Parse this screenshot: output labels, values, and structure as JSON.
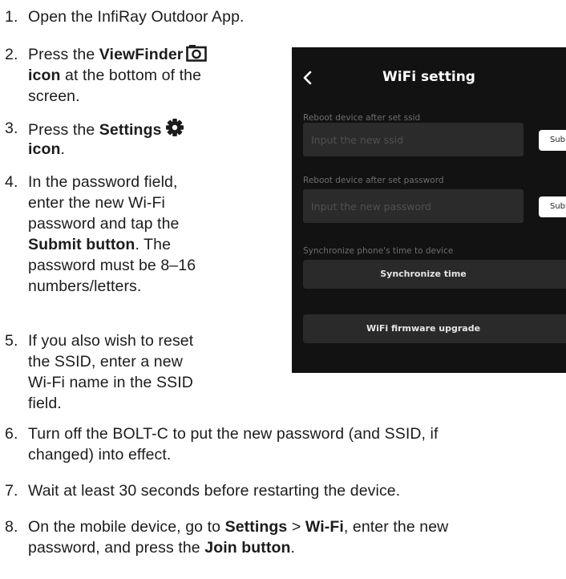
{
  "steps": [
    {
      "num": "1.",
      "lines": [
        "Open the InfiRay Outdoor App."
      ]
    },
    {
      "num": "2.",
      "pre": "Press the ",
      "bold1": "ViewFinder",
      "icon": "camera-icon",
      "line2_bold": "icon",
      "line2_rest": " at the bottom of the",
      "line3": "screen."
    },
    {
      "num": "3.",
      "pre": "Press the ",
      "bold1": "Settings",
      "icon": "gear-icon",
      "line2_bold": "icon",
      "line2_rest": "."
    },
    {
      "num": "4.",
      "lines": [
        "In the password field,",
        "enter the new Wi-Fi",
        "password and tap the"
      ],
      "line4_bold": "Submit button",
      "line4_rest": ". The",
      "line5": "password must be 8–16",
      "line6": "numbers/letters."
    },
    {
      "num": "5.",
      "lines": [
        "If you also wish to reset",
        "the SSID, enter a new",
        "Wi-Fi name in the SSID",
        "field."
      ]
    },
    {
      "num": "6.",
      "lines": [
        "Turn off the BOLT-C to put the new password (and SSID, if",
        "changed) into effect."
      ]
    },
    {
      "num": "7.",
      "lines": [
        "Wait at least 30 seconds before restarting the device."
      ]
    },
    {
      "num": "8.",
      "l1_pre": "On the mobile device, go to ",
      "l1_b1": "Settings",
      "l1_mid": " > ",
      "l1_b2": "Wi-Fi",
      "l1_post": ", enter the new",
      "l2_pre": "password, and press the ",
      "l2_b": "Join button",
      "l2_post": "."
    }
  ],
  "phone": {
    "title": "WiFi setting",
    "ssid_label": "Reboot device after set ssid",
    "ssid_placeholder": "Input the new ssid",
    "submit_label": "Submit",
    "password_label": "Reboot device after set password",
    "password_placeholder": "Input the new password",
    "sync_label": "Synchronize phone's time to device",
    "sync_button": "Synchronize time",
    "firmware_button": "WiFi firmware upgrade",
    "icons": {
      "back": "chevron-left-icon"
    }
  }
}
